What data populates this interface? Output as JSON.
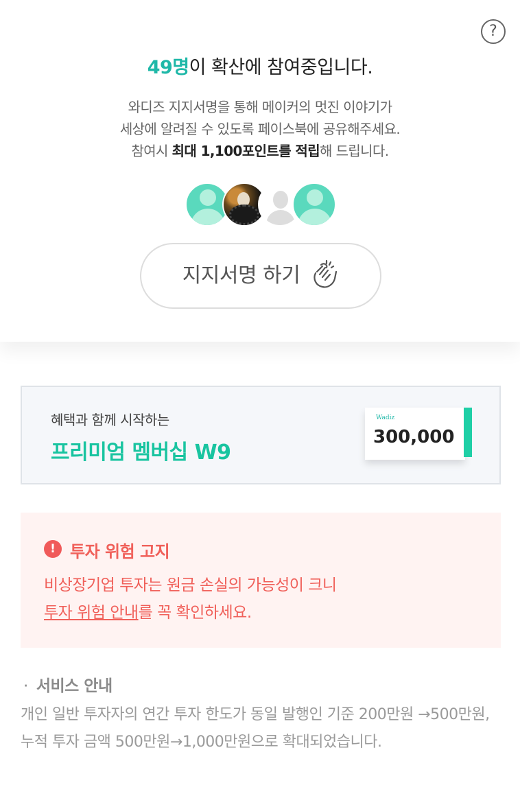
{
  "header": {
    "help_icon": "question-circle-icon",
    "help_symbol": "?",
    "count": "49명",
    "headline_rest": "이 확산에 참여중입니다."
  },
  "description": {
    "line1": "와디즈 지지서명을 통해 메이커의 멋진 이야기가",
    "line2": "세상에 알려질 수 있도록 페이스북에 공유해주세요.",
    "line3_prefix": "참여시 ",
    "line3_bold": "최대 1,100포인트를 적립",
    "line3_suffix": "해 드립니다."
  },
  "avatars": [
    "default-teal",
    "photo",
    "default-gray",
    "default-teal"
  ],
  "sign_button": {
    "label": "지지서명 하기",
    "icon": "clapping-hands-icon"
  },
  "membership": {
    "subtitle": "혜택과 함께 시작하는",
    "title": "프리미엄 멤버십 W9",
    "voucher_brand": "Wadiz",
    "voucher_amount": "300,000"
  },
  "risk_notice": {
    "icon": "exclamation-circle-icon",
    "icon_symbol": "!",
    "title": "투자 위험 고지",
    "line1": "비상장기업 투자는 원금 손실의 가능성이 크니",
    "link": "투자 위험 안내",
    "line2_suffix": "를 꼭 확인하세요."
  },
  "service": {
    "bullet": "·",
    "title": "서비스 안내",
    "body": "개인 일반 투자자의 연간 투자 한도가 동일 발행인 기준 200만원 →500만원, 누적 투자 금액 500만원→1,000만원으로 확대되었습니다."
  },
  "colors": {
    "accent": "#1fb8a8",
    "brand_green": "#19c4a0",
    "risk_red": "#f0605a",
    "risk_bg": "#fff3f2"
  }
}
